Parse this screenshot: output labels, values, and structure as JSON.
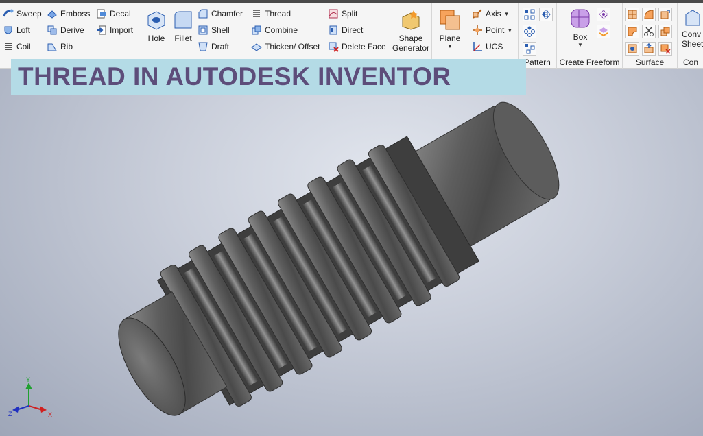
{
  "ribbon": {
    "create_col1": [
      "Sweep",
      "Loft",
      "Coil"
    ],
    "create_col2": [
      "Emboss",
      "Derive",
      "Rib"
    ],
    "create_col3": [
      "Decal",
      "Import"
    ],
    "modify_big": [
      "Hole",
      "Fillet"
    ],
    "modify_col1": [
      "Chamfer",
      "Shell",
      "Draft"
    ],
    "modify_col2": [
      "Thread",
      "Combine",
      "Thicken/ Offset"
    ],
    "modify_col3": [
      "Split",
      "Direct",
      "Delete Face"
    ],
    "shape_generator": [
      "Shape",
      "Generator"
    ],
    "plane": "Plane",
    "work_features": [
      "Axis",
      "Point",
      "UCS"
    ],
    "pattern_label": "Pattern",
    "box": "Box",
    "create_freeform_label": "Create Freeform",
    "surface_label": "Surface",
    "convert": [
      "Conv",
      "Sheet"
    ],
    "convert_label": "Con"
  },
  "banner": {
    "title": "THREAD IN AUTODESK INVENTOR"
  },
  "triad": {
    "x": "X",
    "y": "Y",
    "z": "Z"
  },
  "colors": {
    "banner_bg": "#b4dbe6",
    "banner_text": "#5d4d7a",
    "triad_x": "#d02020",
    "triad_y": "#20a030",
    "triad_z": "#2030c0"
  }
}
